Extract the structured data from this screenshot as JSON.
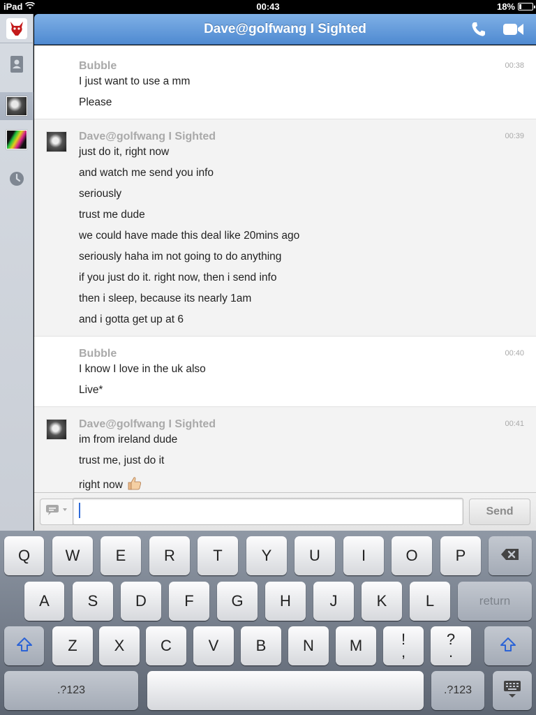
{
  "status_bar": {
    "device": "iPad",
    "time": "00:43",
    "battery": "18%",
    "battery_level": 0.18
  },
  "header": {
    "title": "Dave@golfwang I Sighted"
  },
  "messages": [
    {
      "sender": "Bubble",
      "time": "00:38",
      "lines": [
        "I just want to use a mm",
        "Please"
      ]
    },
    {
      "sender": "Dave@golfwang I Sighted",
      "time": "00:39",
      "lines": [
        "just do it, right now",
        "and watch me send you info",
        "seriously",
        "trust me dude",
        "we could have made this deal like 20mins ago",
        "seriously haha im not going to do anything",
        "if you just do it. right now, then i send info",
        "then i sleep, because its nearly 1am",
        "and i gotta get up at 6"
      ]
    },
    {
      "sender": "Bubble",
      "time": "00:40",
      "lines": [
        "I know I love in the uk also",
        "Live*"
      ]
    },
    {
      "sender": "Dave@golfwang I Sighted",
      "time": "00:41",
      "lines": [
        "im from ireland dude",
        "trust me, just do it",
        "right now"
      ]
    }
  ],
  "compose": {
    "value": "",
    "send_label": "Send"
  },
  "keyboard": {
    "row1": [
      "Q",
      "W",
      "E",
      "R",
      "T",
      "Y",
      "U",
      "I",
      "O",
      "P"
    ],
    "row2": [
      "A",
      "S",
      "D",
      "F",
      "G",
      "H",
      "J",
      "K",
      "L"
    ],
    "row3": [
      "Z",
      "X",
      "C",
      "V",
      "B",
      "N",
      "M"
    ],
    "return_label": "return",
    "numbers_label": ".?123",
    "excl_top": "!",
    "excl_bottom": ",",
    "quest_top": "?",
    "quest_bottom": "."
  }
}
